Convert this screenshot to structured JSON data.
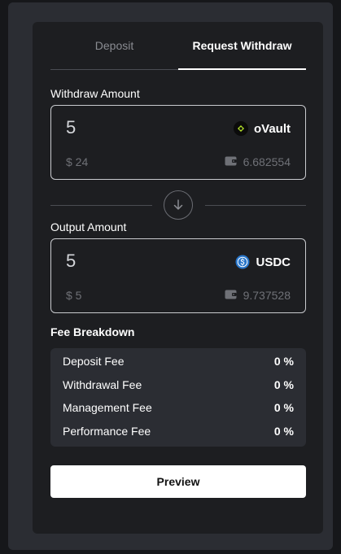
{
  "tabs": [
    {
      "label": "Deposit",
      "active": false
    },
    {
      "label": "Request Withdraw",
      "active": true
    }
  ],
  "withdraw": {
    "label": "Withdraw Amount",
    "amount": "5",
    "token": "oVault",
    "token_icon": "ovault-logo-icon",
    "usd_value": "$ 24",
    "balance": "6.682554",
    "balance_icon": "wallet-icon"
  },
  "swap_icon": "arrow-down-icon",
  "output": {
    "label": "Output Amount",
    "amount": "5",
    "token": "USDC",
    "token_icon": "usdc-logo-icon",
    "usd_value": "$ 5",
    "balance": "9.737528",
    "balance_icon": "wallet-icon"
  },
  "fees": {
    "title": "Fee Breakdown",
    "rows": [
      {
        "label": "Deposit Fee",
        "value": "0 %"
      },
      {
        "label": "Withdrawal Fee",
        "value": "0 %"
      },
      {
        "label": "Management Fee",
        "value": "0 %"
      },
      {
        "label": "Performance Fee",
        "value": "0 %"
      }
    ]
  },
  "preview_label": "Preview",
  "colors": {
    "page_bg": "#16171a",
    "outer_panel": "#2b2d33",
    "card_bg": "#1d1e21",
    "ovault_accent": "#b5e32b",
    "usdc_blue": "#2775ca",
    "muted_text": "#6f7177"
  }
}
